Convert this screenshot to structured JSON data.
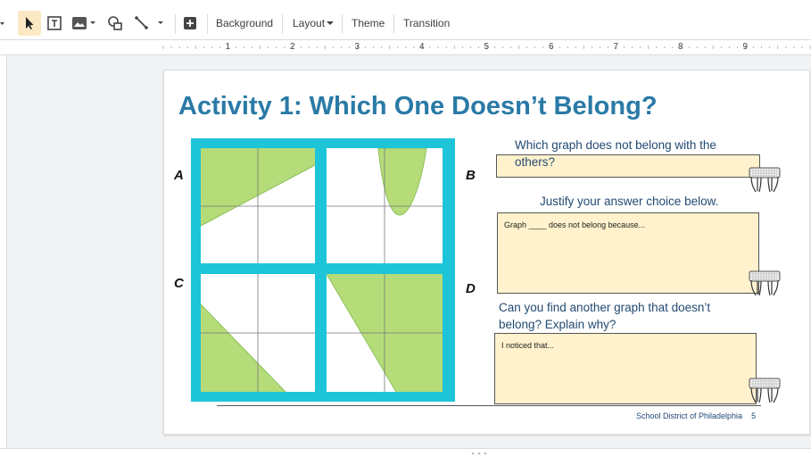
{
  "toolbar": {
    "background_label": "Background",
    "layout_label": "Layout",
    "theme_label": "Theme",
    "transition_label": "Transition",
    "icons": [
      "dropdown-arrow-icon",
      "select-cursor-icon",
      "text-box-icon",
      "image-icon",
      "shape-icon",
      "line-icon",
      "new-slide-icon"
    ]
  },
  "ruler": {
    "ticks": [
      "1",
      "2",
      "3",
      "4",
      "5",
      "6",
      "7",
      "8",
      "9"
    ]
  },
  "slide": {
    "title": "Activity 1: Which One Doesn’t Belong?",
    "graph_labels": {
      "a": "A",
      "b": "B",
      "c": "C",
      "d": "D"
    },
    "q1_line1": "Which graph does not belong with the",
    "q1_line2": "others?",
    "q2": "Justify your answer choice below.",
    "box2_text": "Graph ____ does not belong because...",
    "q3_line1": "Can you find another graph that doesn’t",
    "q3_line2": "belong? Explain why?",
    "box3_text": "I noticed that...",
    "footer": "School District of Philadelphia    5",
    "colors": {
      "title": "#2a7aa6",
      "frame": "#1ec4d8",
      "shade": "#b5dc79",
      "answer_box": "#fff2cc"
    }
  }
}
